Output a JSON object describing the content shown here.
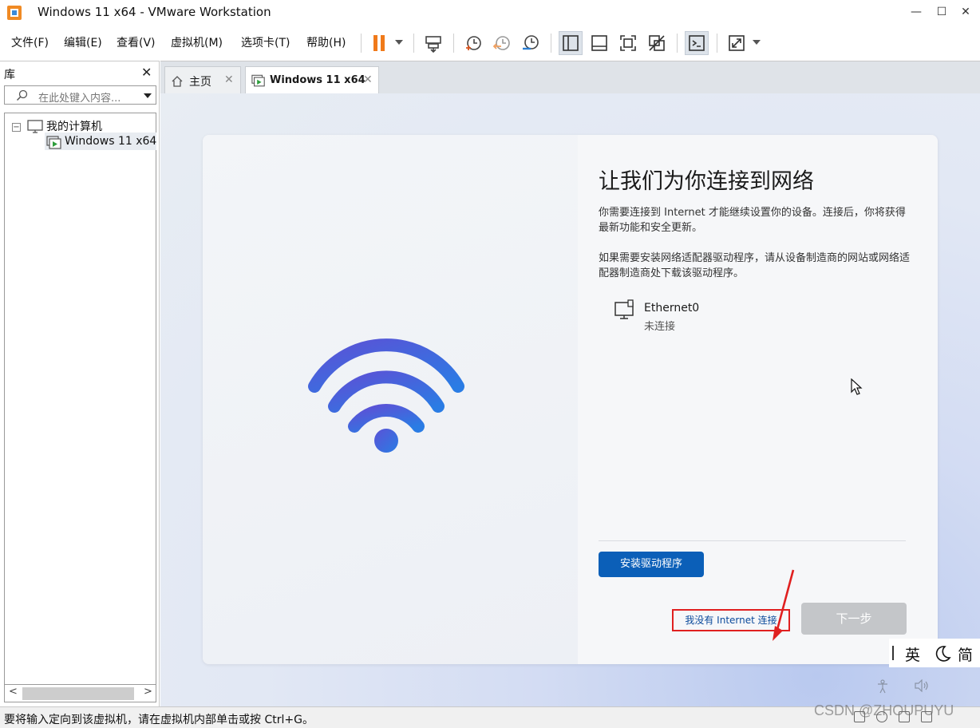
{
  "window": {
    "title": "Windows 11 x64 - VMware Workstation",
    "controls": {
      "minimize": "—",
      "maximize": "☐",
      "close": "✕"
    }
  },
  "menu": {
    "items": [
      "文件(F)",
      "编辑(E)",
      "查看(V)",
      "虚拟机(M)",
      "选项卡(T)",
      "帮助(H)"
    ]
  },
  "toolbar": {
    "icons": [
      "pause-icon",
      "send-keys-icon",
      "snapshot-take-icon",
      "snapshot-revert-icon",
      "snapshot-manager-icon",
      "library-view-icon",
      "thumbnail-view-icon",
      "fullscreen-icon",
      "unity-icon",
      "console-icon",
      "stretch-icon"
    ],
    "accent_pause": "#f07a1a"
  },
  "library": {
    "title": "库",
    "close": "✕",
    "search_placeholder": "在此处键入内容...",
    "tree": {
      "root": {
        "label": "我的计算机",
        "expander": "−"
      },
      "vm": {
        "label": "Windows 11 x64"
      }
    },
    "scroll_left": "<",
    "scroll_right": ">"
  },
  "tabs": [
    {
      "label": "主页",
      "close": "✕",
      "active": false
    },
    {
      "label": "Windows 11 x64",
      "close": "✕",
      "active": true
    }
  ],
  "oobe": {
    "title": "让我们为你连接到网络",
    "para1": "你需要连接到 Internet 才能继续设置你的设备。连接后，你将获得最新功能和安全更新。",
    "para2": "如果需要安装网络适配器驱动程序，请从设备制造商的网站或网络适配器制造商处下载该驱动程序。",
    "network": {
      "name": "Ethernet0",
      "status": "未连接"
    },
    "install_button": "安装驱动程序",
    "no_internet_link": "我没有 Internet 连接",
    "next_button": "下一步",
    "colors": {
      "primary": "#0b5fb8",
      "highlight": "#e02020",
      "disabled": "#c4c6c9"
    }
  },
  "ime": {
    "lang": "英",
    "mode_icon": "moon-icon",
    "script": "简"
  },
  "statusbar": {
    "text": "要将输入定向到该虚拟机，请在虚拟机内部单击或按 Ctrl+G。",
    "watermark": "CSDN @ZHOUPUYU"
  }
}
